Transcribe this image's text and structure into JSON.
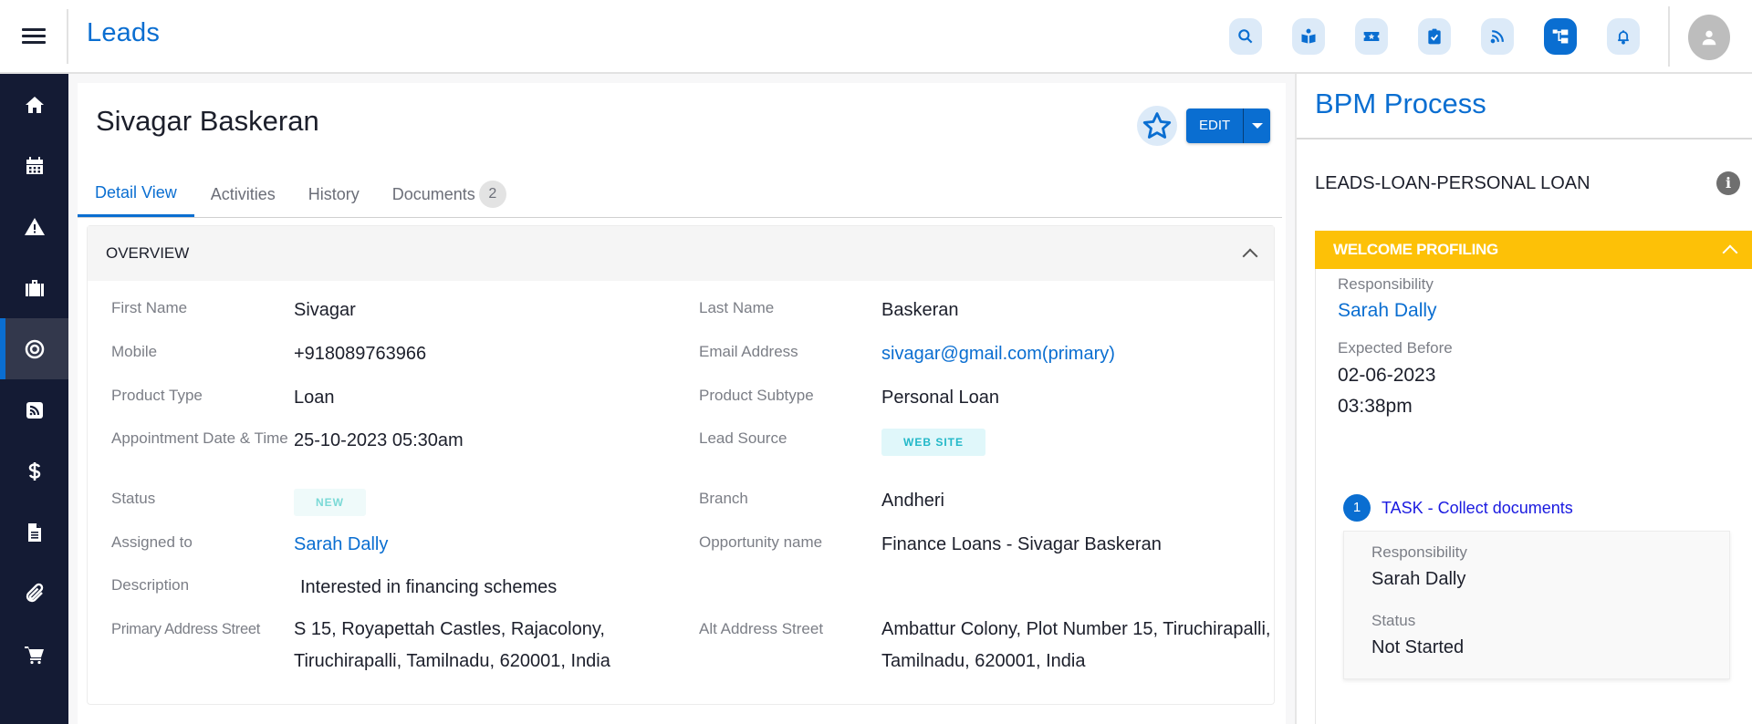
{
  "header": {
    "app_title": "Leads",
    "icons": [
      {
        "name": "search-icon",
        "active": false
      },
      {
        "name": "book-reader-icon",
        "active": false
      },
      {
        "name": "ticket-star-icon",
        "active": false
      },
      {
        "name": "clipboard-check-icon",
        "active": false
      },
      {
        "name": "rss-feed-icon",
        "active": false
      },
      {
        "name": "process-tree-icon",
        "active": true
      },
      {
        "name": "bell-icon",
        "active": false
      }
    ],
    "accent_color": "#0a6ed1"
  },
  "sidebar": {
    "items": [
      {
        "icon": "home-icon",
        "active": false
      },
      {
        "icon": "calendar-icon",
        "active": false
      },
      {
        "icon": "warning-icon",
        "active": false
      },
      {
        "icon": "briefcase-icon",
        "active": false
      },
      {
        "icon": "target-icon",
        "active": true
      },
      {
        "icon": "rss-square-icon",
        "active": false
      },
      {
        "icon": "dollar-icon",
        "active": false
      },
      {
        "icon": "document-icon",
        "active": false
      },
      {
        "icon": "paperclip-icon",
        "active": false
      },
      {
        "icon": "cart-icon",
        "active": false
      }
    ]
  },
  "lead": {
    "name": "Sivagar Baskeran",
    "edit_label": "EDIT"
  },
  "tabs": [
    {
      "label": "Detail View",
      "active": true
    },
    {
      "label": "Activities",
      "active": false
    },
    {
      "label": "History",
      "active": false
    },
    {
      "label": "Documents",
      "active": false,
      "badge": "2"
    }
  ],
  "overview": {
    "title": "OVERVIEW",
    "left_fields": [
      {
        "label": "First Name",
        "value": "Sivagar"
      },
      {
        "label": "Mobile",
        "value": "+918089763966"
      },
      {
        "label": "Product Type",
        "value": "Loan"
      },
      {
        "label": "Appointment Date & Time",
        "value": "25-10-2023 05:30am"
      },
      {
        "label": "Status",
        "value": "NEW"
      },
      {
        "label": "Assigned to",
        "value": "Sarah Dally"
      },
      {
        "label": "Description",
        "value": "Interested in financing schemes"
      },
      {
        "label": "Primary Address Street",
        "value": "S 15, Royapettah Castles, Rajacolony, Tiruchirapalli, Tamilnadu, 620001, India"
      }
    ],
    "right_fields": [
      {
        "label": "Last Name",
        "value": "Baskeran"
      },
      {
        "label": "Email Address",
        "value": "sivagar@gmail.com(primary)"
      },
      {
        "label": "Product Subtype",
        "value": "Personal Loan"
      },
      {
        "label": "Lead Source",
        "value": "WEB SITE"
      },
      {
        "label": "Branch",
        "value": "Andheri"
      },
      {
        "label": "Opportunity name",
        "value": "Finance Loans - Sivagar Baskeran"
      },
      {
        "label": "Alt Address Street",
        "value": "Ambattur Colony, Plot Number 15, Tiruchirapalli, Tamilnadu, 620001, India"
      }
    ]
  },
  "bpm": {
    "title": "BPM Process",
    "process_name": "LEADS-LOAN-PERSONAL LOAN",
    "stage": {
      "title": "WELCOME PROFILING",
      "color": "#fdc107",
      "responsibility_label": "Responsibility",
      "responsibility": "Sarah Dally",
      "expected_before_label": "Expected Before",
      "expected_date": "02-06-2023",
      "expected_time": "03:38pm"
    },
    "task": {
      "number": "1",
      "title": "TASK - Collect documents",
      "responsibility_label": "Responsibility",
      "responsibility": "Sarah Dally",
      "status_label": "Status",
      "status": "Not Started"
    }
  }
}
